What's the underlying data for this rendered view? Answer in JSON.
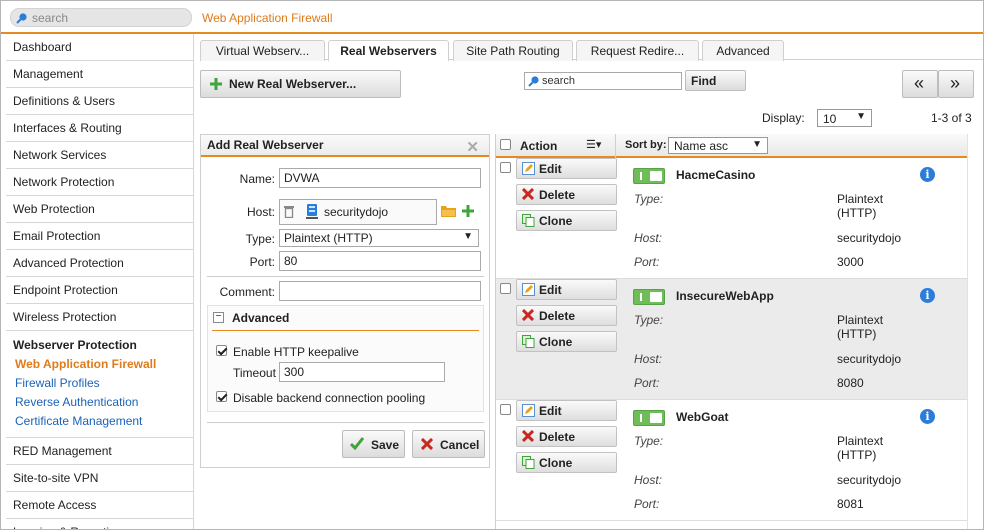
{
  "search": {
    "placeholder": "search"
  },
  "app_title": "Web Application Firewall",
  "sidebar": {
    "items_top": [
      "Dashboard",
      "Management",
      "Definitions & Users",
      "Interfaces & Routing",
      "Network Services",
      "Network Protection",
      "Web Protection",
      "Email Protection",
      "Advanced Protection",
      "Endpoint Protection",
      "Wireless Protection"
    ],
    "group": {
      "title": "Webserver Protection",
      "subs": [
        "Web Application Firewall",
        "Firewall Profiles",
        "Reverse Authentication",
        "Certificate Management"
      ]
    },
    "items_bottom": [
      "RED Management",
      "Site-to-site VPN",
      "Remote Access",
      "Logging & Reporting"
    ]
  },
  "tabs": [
    "Virtual Webserv...",
    "Real Webservers",
    "Site Path Routing",
    "Request Redire...",
    "Advanced"
  ],
  "toolbar": {
    "new_label": "New Real Webserver...",
    "search_value": "search",
    "find_label": "Find",
    "prev_label": "«",
    "next_label": "»"
  },
  "display": {
    "label": "Display:",
    "value": "10",
    "count": "1-3 of 3"
  },
  "panel": {
    "title": "Add Real Webserver",
    "name_label": "Name:",
    "name_value": "DVWA",
    "host_label": "Host:",
    "host_value": "securitydojo",
    "type_label": "Type:",
    "type_value": "Plaintext (HTTP)",
    "port_label": "Port:",
    "port_value": "80",
    "comment_label": "Comment:",
    "comment_value": "",
    "advanced_label": "Advanced",
    "keepalive_label": "Enable HTTP keepalive",
    "timeout_label": "Timeout",
    "timeout_value": "300",
    "pooling_label": "Disable backend connection pooling",
    "save_label": "Save",
    "cancel_label": "Cancel"
  },
  "list": {
    "action_label": "Action",
    "sort_label": "Sort by:",
    "sort_value": "Name asc",
    "btn_edit": "Edit",
    "btn_delete": "Delete",
    "btn_clone": "Clone",
    "type_key": "Type:",
    "host_key": "Host:",
    "port_key": "Port:",
    "rows": [
      {
        "name": "HacmeCasino",
        "type1": "Plaintext",
        "type2": "(HTTP)",
        "host": "securitydojo",
        "port": "3000"
      },
      {
        "name": "InsecureWebApp",
        "type1": "Plaintext",
        "type2": "(HTTP)",
        "host": "securitydojo",
        "port": "8080"
      },
      {
        "name": "WebGoat",
        "type1": "Plaintext",
        "type2": "(HTTP)",
        "host": "securitydojo",
        "port": "8081"
      }
    ]
  },
  "colors": {
    "accent": "#e58a1f",
    "link": "#1b62b8",
    "toggle_on": "#6fbd58",
    "info": "#2a7dd8"
  }
}
